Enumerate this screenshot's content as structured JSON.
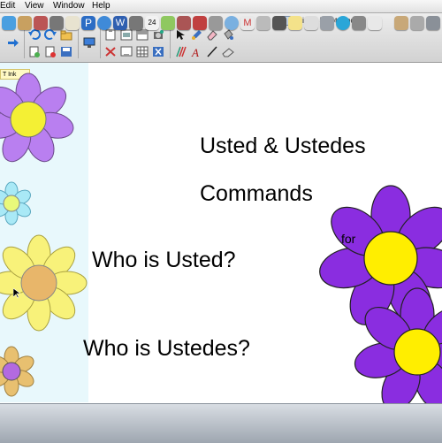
{
  "menu": {
    "edit": "Edit",
    "view": "View",
    "window": "Window",
    "help": "Help"
  },
  "window_title": "unidad 5.notebook",
  "ink_label": "T Ink",
  "slide": {
    "title_line1": "Usted & Ustedes",
    "title_line2": "Commands",
    "question1": "Who is Usted?",
    "question2": "Who is Ustedes?",
    "partial_text": "for"
  },
  "toolbar_icons": [
    "arrow-right-icon",
    "undo-icon",
    "redo-icon",
    "open-folder-icon",
    "new-page-icon",
    "delete-page-icon",
    "save-icon",
    "screen-display-icon",
    "paste-icon",
    "clear-page-icon",
    "screen-shade-icon",
    "table-icon",
    "capture-icon",
    "magic-pen-icon",
    "select-arrow-icon",
    "pen-icon",
    "line-icon",
    "text-icon",
    "eraser-icon",
    "shape-icon",
    "fill-icon",
    "creative-pen-icon"
  ],
  "dock_colors": {
    "finder": "#4a9fe0",
    "mail": "#c8a060",
    "safari": "#3f8ad8",
    "word": "#2f5fb0",
    "calendar": "#f2f2f2",
    "itunes": "#7ab0e0",
    "photo": "#8fc860",
    "gmail": "#e8e8e8",
    "notes": "#f4e28a",
    "system": "#9aa0a8"
  },
  "colors": {
    "side_panel": "#e8f8fc",
    "flower_purple": "#b97ff0",
    "flower_center_yellow": "#f4f034",
    "flower_cyan": "#a9e9f6",
    "flower_yellow": "#f8f27a",
    "flower_orange_center": "#e8b66a",
    "big_flower_purple": "#8a2de0",
    "big_flower_center": "#ffee00"
  }
}
